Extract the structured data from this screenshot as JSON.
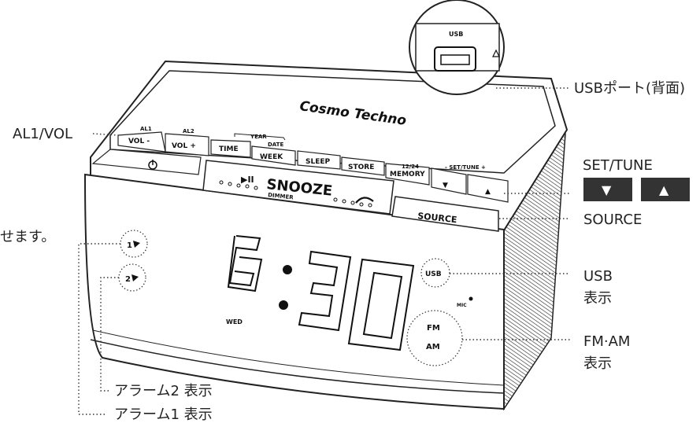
{
  "brand": "Cosmo Techno",
  "usb_inset_label": "USB",
  "display": {
    "digits": "6:30",
    "day": "WED"
  },
  "indicators": {
    "usb": "USB",
    "fm": "FM",
    "am": "AM",
    "mic": "MIC",
    "alarm1": "1",
    "alarm2": "2"
  },
  "buttons": {
    "al1_small": "AL1",
    "vol_minus": "VOL -",
    "al2_small": "AL2",
    "vol_plus": "VOL +",
    "year": "YEAR",
    "date": "DATE",
    "time": "TIME",
    "week": "WEEK",
    "sleep": "SLEEP",
    "store": "STORE",
    "mem_small": "12/24",
    "memory": "MEMORY",
    "settune_small": "- SET/TUNE +",
    "down": "▼",
    "up": "▲",
    "snooze_play": "▶II",
    "snooze": "SNOOZE",
    "dimmer": "DIMMER",
    "source": "SOURCE"
  },
  "callouts": {
    "al1vol": "AL1/VOL",
    "usb_port": "USBポート(背面)",
    "set_tune": "SET/TUNE",
    "source": "SOURCE",
    "usb_disp_1": "USB",
    "usb_disp_2": "表示",
    "fmam_1": "FM·AM",
    "fmam_2": "表示",
    "alarm2": "アラーム2 表示",
    "alarm1": "アラーム1 表示",
    "truncated_left": "せます。"
  },
  "set_tune_icons": [
    "▼",
    "▲"
  ]
}
